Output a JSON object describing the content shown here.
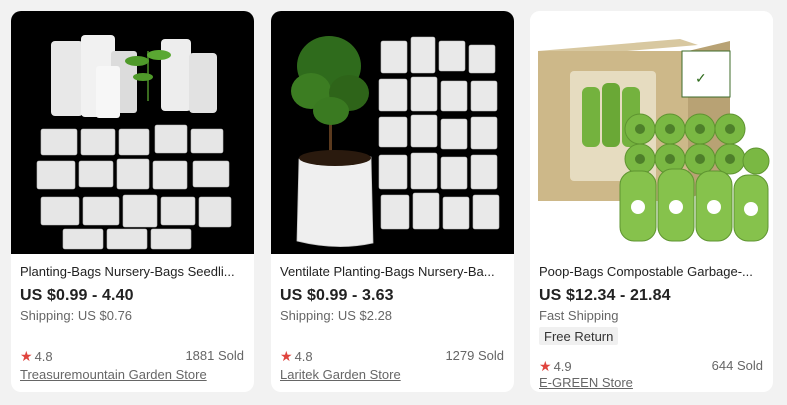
{
  "products": [
    {
      "title": "Planting-Bags Nursery-Bags Seedli...",
      "price": "US $0.99 - 4.40",
      "shipping": "Shipping: US $0.76",
      "rating": "4.8",
      "sold": "1881 Sold",
      "store": "Treasuremountain Garden Store",
      "image": "nursery-bags-photo"
    },
    {
      "title": "Ventilate Planting-Bags Nursery-Ba...",
      "price": "US $0.99 - 3.63",
      "shipping": "Shipping: US $2.28",
      "rating": "4.8",
      "sold": "1279 Sold",
      "store": "Laritek Garden Store",
      "image": "plant-in-bag-photo"
    },
    {
      "title": "Poop-Bags Compostable Garbage-...",
      "price": "US $12.34 - 21.84",
      "shipping": "Fast Shipping",
      "badge": "Free Return",
      "rating": "4.9",
      "sold": "644 Sold",
      "store": "E-GREEN Store",
      "image": "poop-bags-box-photo"
    }
  ],
  "colors": {
    "page_bg": "#f2f2f2",
    "star": "#e0443e",
    "bag_green": "#7cb342"
  }
}
